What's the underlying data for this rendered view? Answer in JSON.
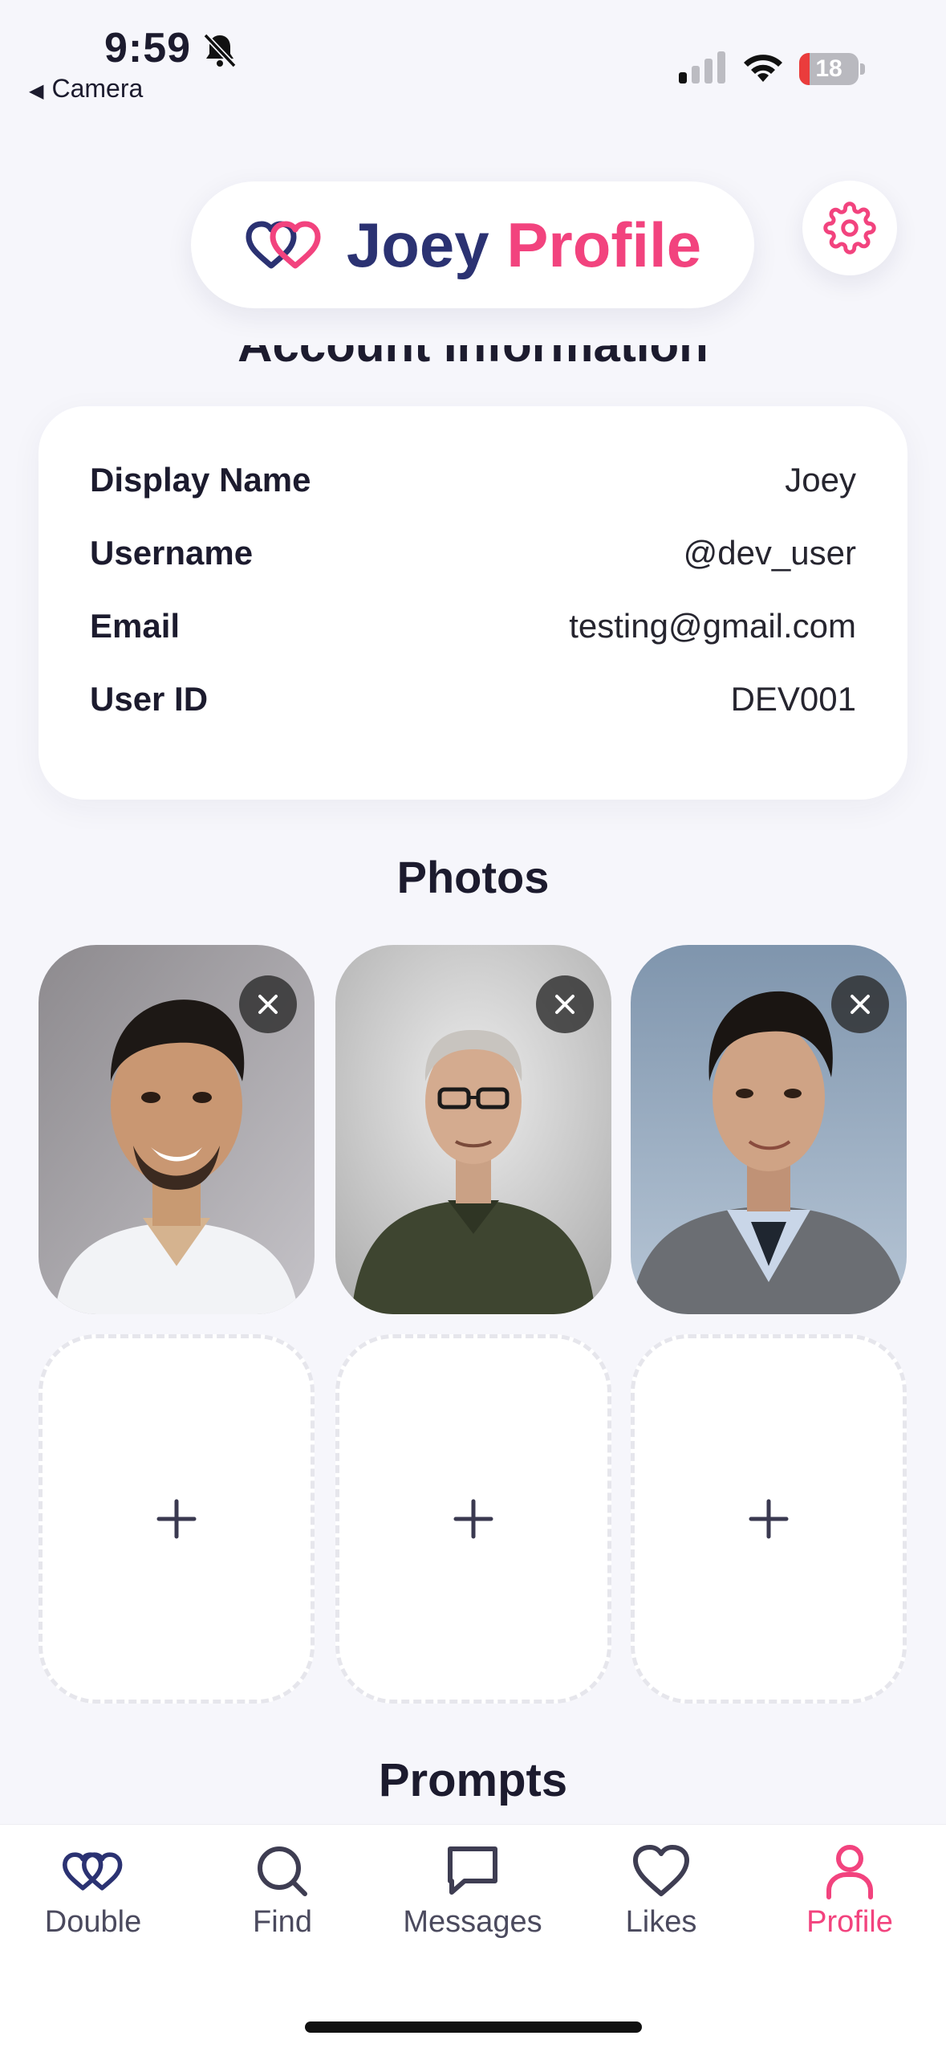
{
  "status_bar": {
    "time": "9:59",
    "back_label": "Camera",
    "battery_level": "18",
    "battery_fraction": 0.18
  },
  "header": {
    "name": "Joey",
    "title_suffix": "Profile",
    "settings_icon": "gear-icon",
    "logo_icon": "double-heart-icon"
  },
  "account": {
    "section_title": "Account Information",
    "rows": [
      {
        "label": "Display Name",
        "value": "Joey"
      },
      {
        "label": "Username",
        "value": "@dev_user"
      },
      {
        "label": "Email",
        "value": "testing@gmail.com"
      },
      {
        "label": "User ID",
        "value": "DEV001"
      }
    ]
  },
  "photos": {
    "section_title": "Photos",
    "filled_count": 3,
    "empty_count": 3
  },
  "prompts": {
    "section_title": "Prompts"
  },
  "tabs": [
    {
      "label": "Double",
      "icon": "double-heart-icon",
      "active": false
    },
    {
      "label": "Find",
      "icon": "search-icon",
      "active": false
    },
    {
      "label": "Messages",
      "icon": "message-icon",
      "active": false
    },
    {
      "label": "Likes",
      "icon": "heart-icon",
      "active": false
    },
    {
      "label": "Profile",
      "icon": "person-icon",
      "active": true
    }
  ],
  "colors": {
    "accent_pink": "#f2437e",
    "navy": "#2b3272",
    "background": "#f6f6fb"
  }
}
